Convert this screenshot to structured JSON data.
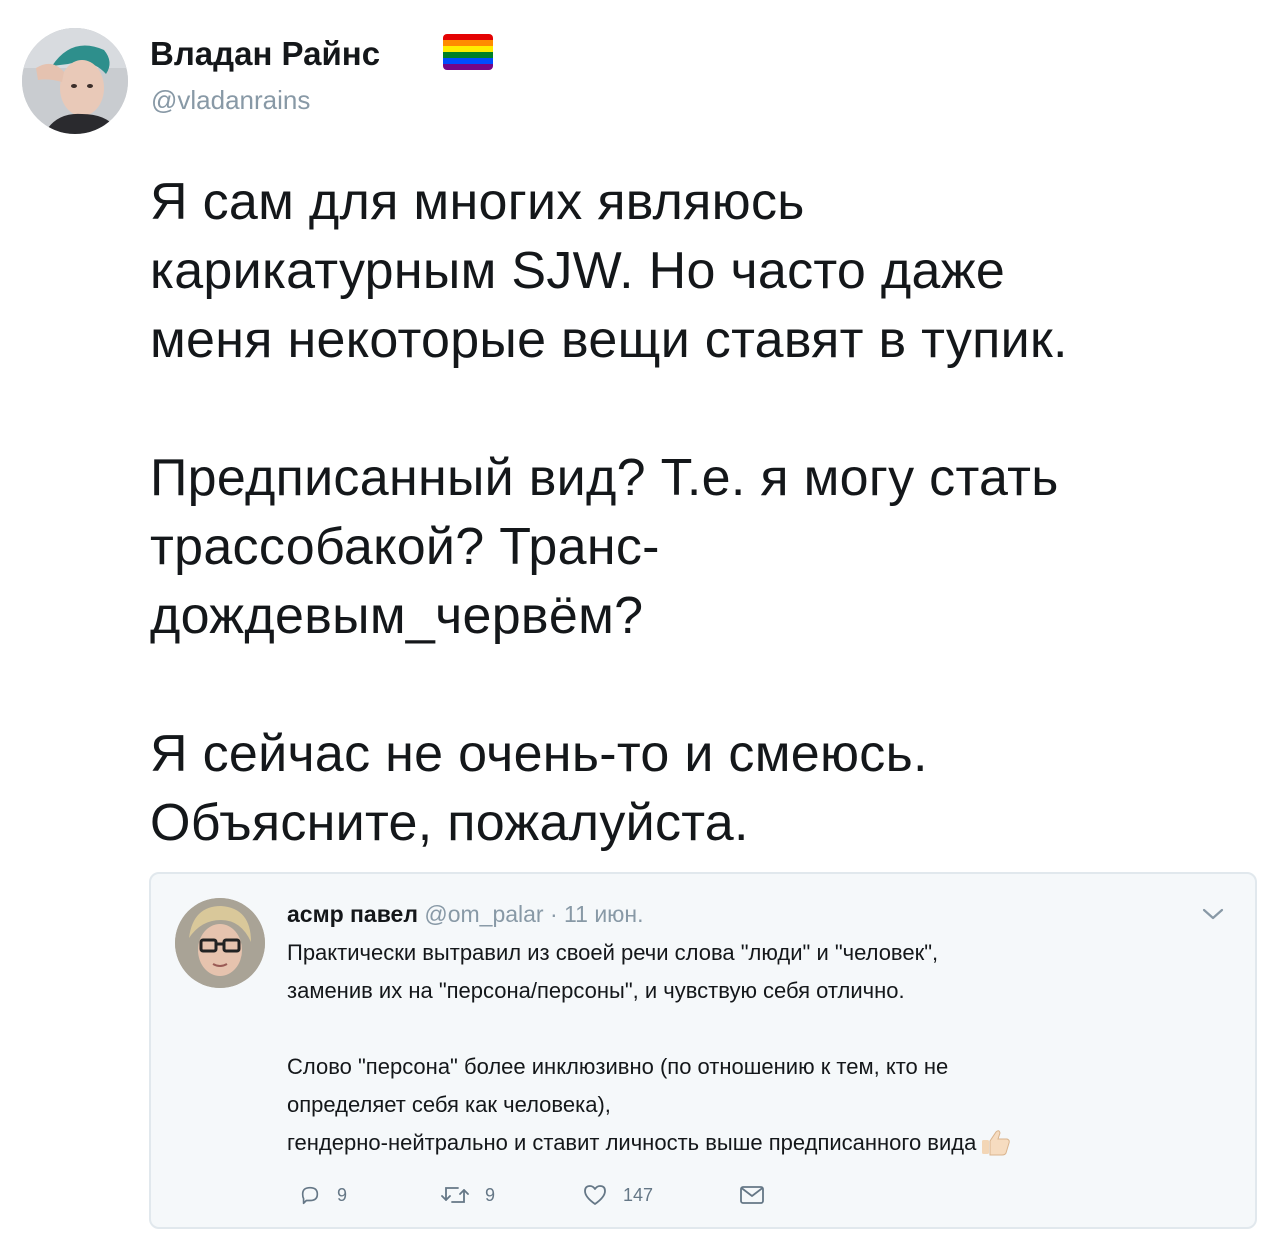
{
  "tweet": {
    "author_name": "Владан Райнс",
    "author_handle": "@vladanrains",
    "badge_icon": "rainbow-flag-icon",
    "paragraphs": [
      [
        "Я сам для многих являюсь",
        "карикатурным SJW. Но часто даже",
        "меня некоторые вещи ставят в тупик."
      ],
      [
        "Предписанный вид? Т.е. я могу стать",
        "трассобакой? Транс-",
        "дождевым_червём?"
      ],
      [
        "Я сейчас не очень-то и смеюсь.",
        "Объясните, пожалуйста."
      ]
    ]
  },
  "quoted": {
    "author_name": "асмр павел",
    "author_handle": "@om_palar",
    "separator": "·",
    "date": "11 июн.",
    "lines_1": [
      "Практически вытравил из своей речи слова \"люди\" и \"человек\",",
      "заменив их на \"персона/персоны\", и чувствую себя отлично."
    ],
    "lines_2": [
      "Слово \"персона\" более инклюзивно (по отношению к тем, кто не",
      "определяет себя как человека),",
      "гендерно-нейтрально и ставит личность выше предписанного вида"
    ],
    "trailing_emoji_icon": "thumbs-up-icon",
    "actions": {
      "replies": "9",
      "retweets": "9",
      "likes": "147"
    }
  },
  "colors": {
    "text": "#14171a",
    "secondary": "#8899a6",
    "card_bg": "#f5f8fa",
    "card_border": "#e1e8ed",
    "flag": [
      "#e40303",
      "#ff8c00",
      "#ffed00",
      "#008026",
      "#004dff",
      "#750787"
    ]
  }
}
